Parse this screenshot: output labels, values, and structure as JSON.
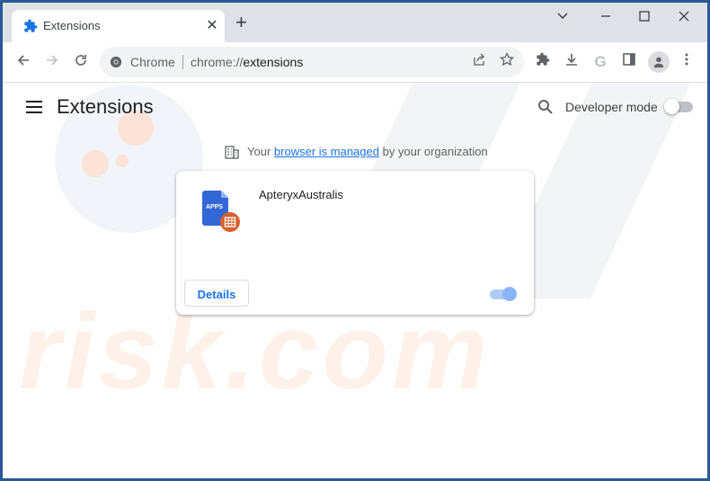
{
  "browser": {
    "tab": {
      "title": "Extensions",
      "icon": "puzzle-icon"
    },
    "new_tab_label": "+",
    "window_controls": {
      "dropdown": "⌄",
      "minimize": "–",
      "maximize": "☐",
      "close": "✕"
    },
    "omnibox": {
      "site_label": "Chrome",
      "url_prefix": "chrome://",
      "url_path": "extensions"
    },
    "toolbar_icons": [
      "share-icon",
      "star-icon",
      "extensions-puzzle-icon",
      "download-icon",
      "google-g-icon",
      "side-panel-icon",
      "profile-avatar-icon",
      "kebab-menu-icon"
    ]
  },
  "page": {
    "title": "Extensions",
    "search_icon": "search-icon",
    "developer_mode": {
      "label": "Developer mode",
      "enabled": false
    },
    "managed_notice": {
      "prefix": "Your",
      "link_text": "browser is managed",
      "suffix": "by your organization"
    }
  },
  "extensions": [
    {
      "name": "ApteryxAustralis",
      "icon_label": "APPS",
      "details_label": "Details",
      "enabled": true
    }
  ],
  "colors": {
    "accent": "#1a73e8",
    "toggle_on_track": "#aecbfa",
    "toggle_on_knob": "#8ab4f8",
    "tab_bar": "#dee1e6",
    "frame": "#2b5797"
  },
  "watermark": {
    "text": "risk.com"
  }
}
